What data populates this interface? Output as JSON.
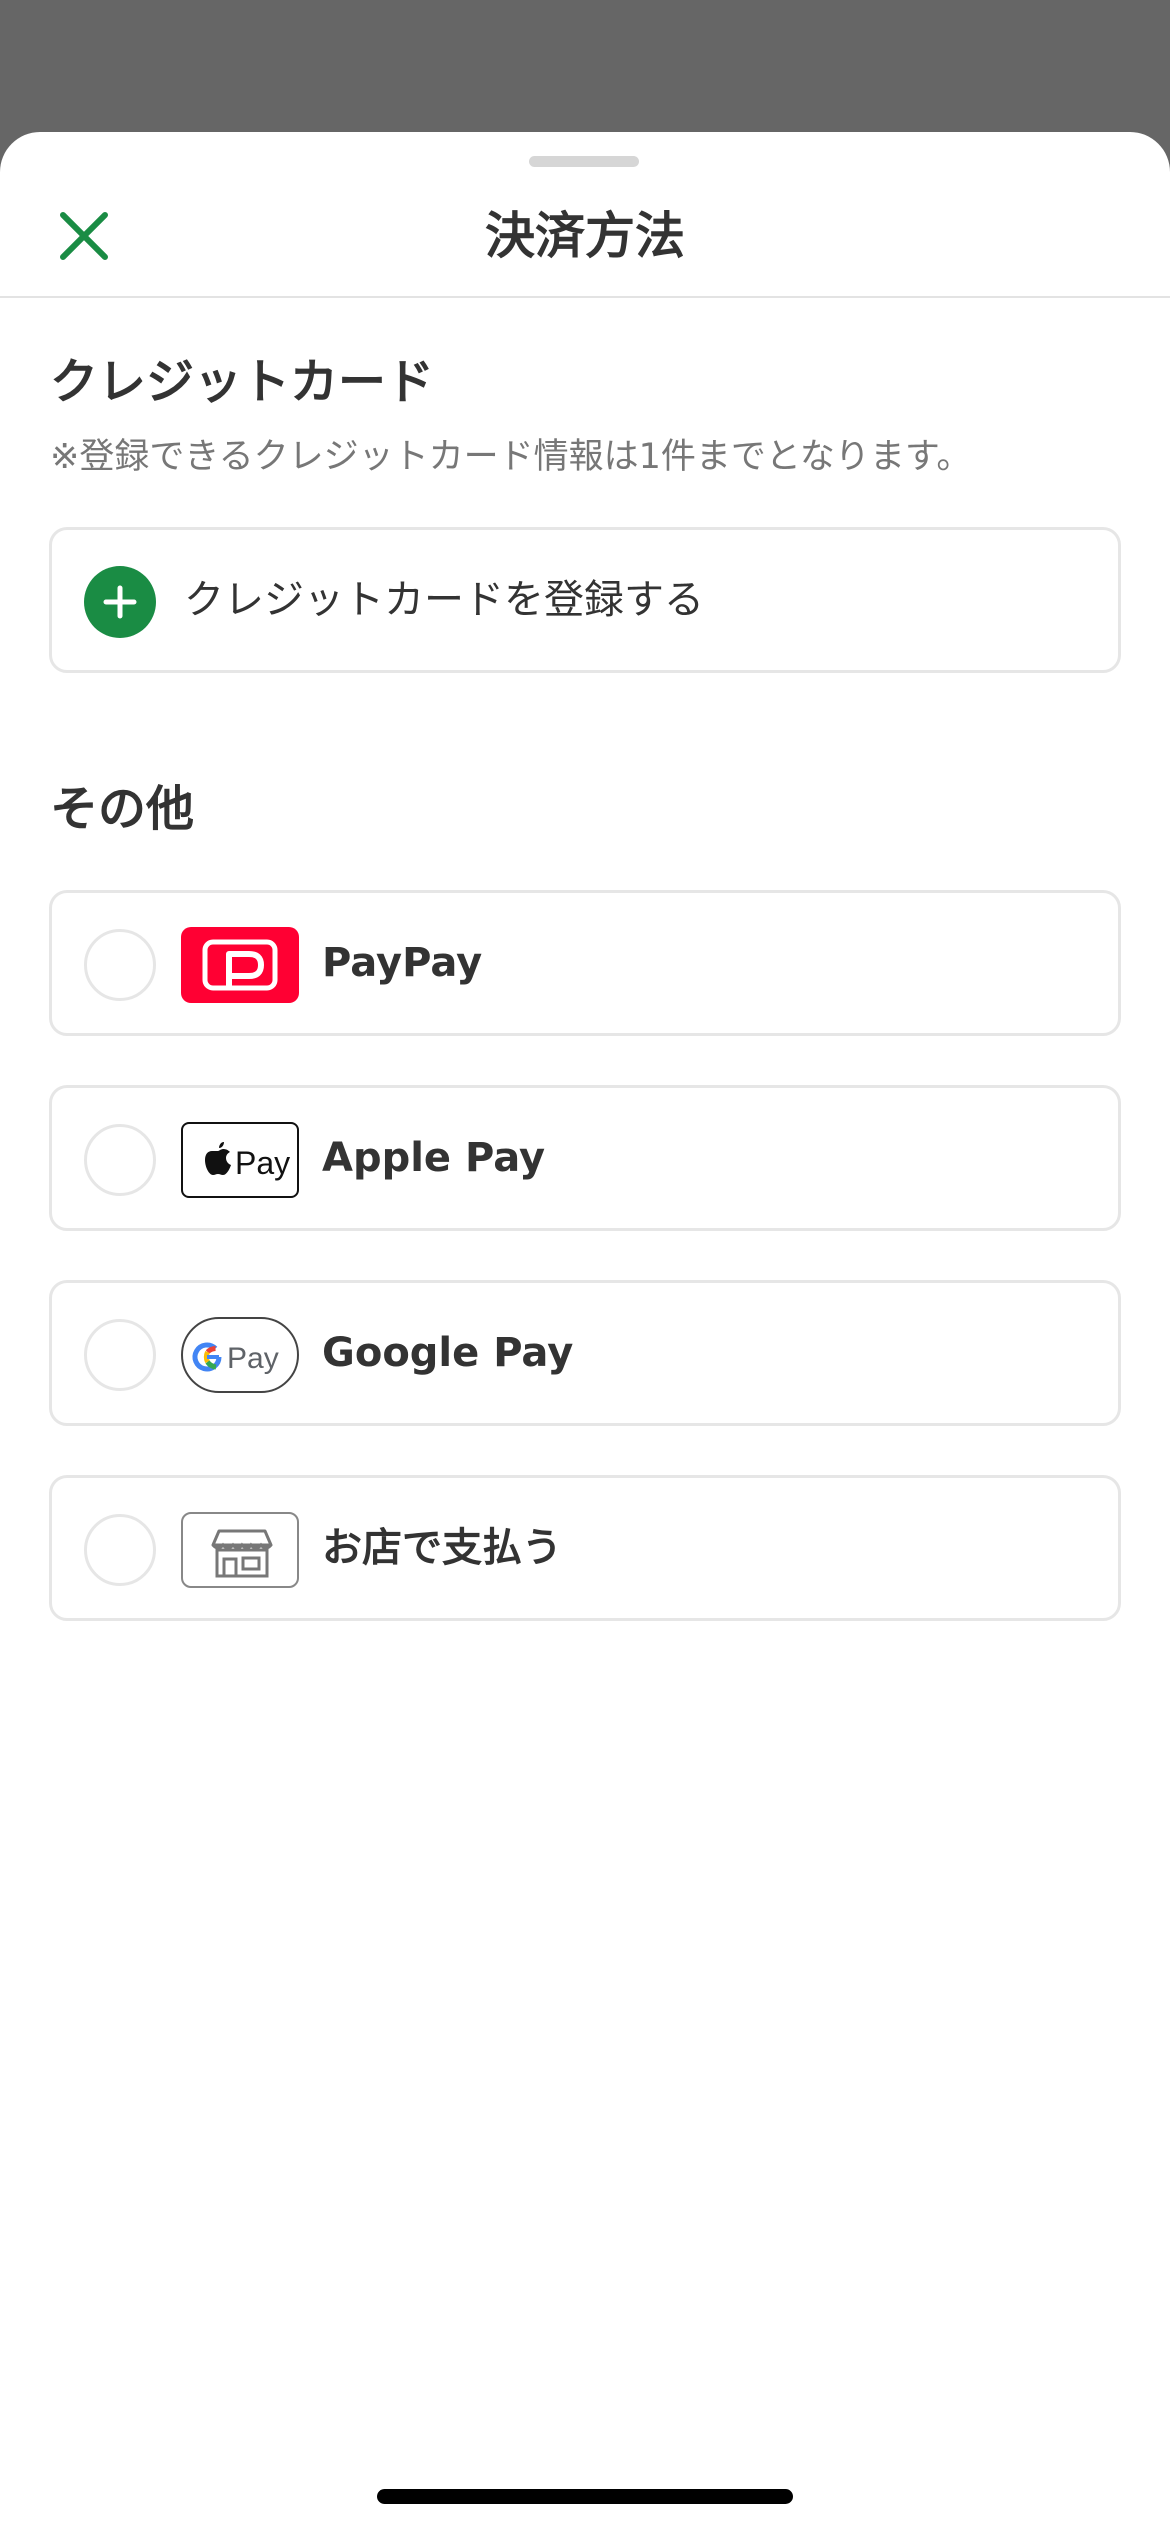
{
  "header": {
    "title": "決済方法",
    "close_icon": "close-icon"
  },
  "credit_card": {
    "section_title": "クレジットカード",
    "note": "※登録できるクレジットカード情報は1件までとなります。",
    "add_label": "クレジットカードを登録する",
    "add_icon": "plus-circle-icon"
  },
  "other": {
    "section_title": "その他",
    "options": [
      {
        "label": "PayPay",
        "icon": "paypay-logo-icon",
        "selected": false
      },
      {
        "label": "Apple Pay",
        "icon": "apple-pay-logo-icon",
        "logo_text": "Pay",
        "selected": false
      },
      {
        "label": "Google Pay",
        "icon": "google-pay-logo-icon",
        "logo_text": "Pay",
        "selected": false
      },
      {
        "label": "お店で支払う",
        "icon": "store-icon",
        "selected": false
      }
    ]
  },
  "colors": {
    "accent": "#1a8c44",
    "paypay_red": "#ff0033",
    "backdrop": "#666666",
    "border": "#e6e6e6",
    "text": "#333333",
    "subtext": "#777777"
  }
}
